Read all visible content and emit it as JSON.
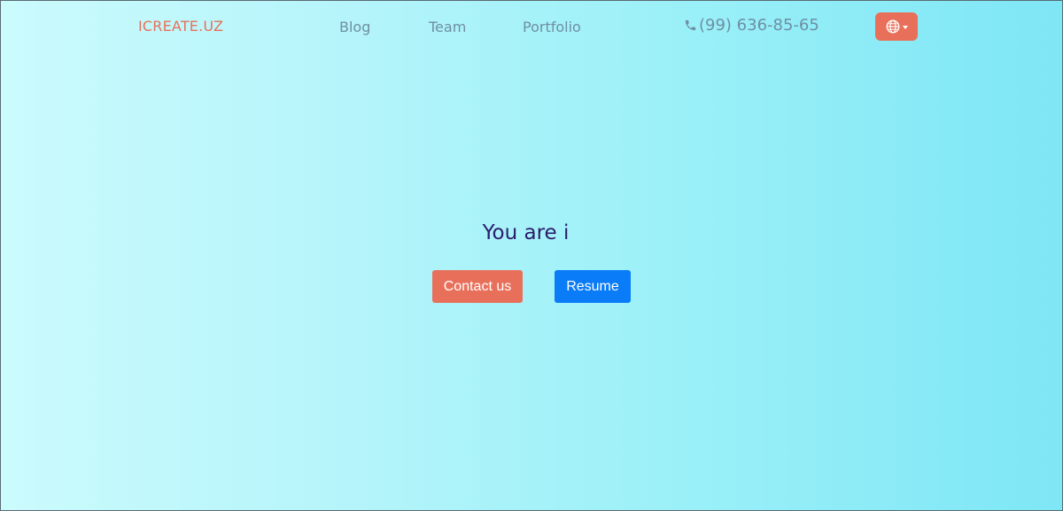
{
  "navbar": {
    "brand": "ICREATE.UZ",
    "links": [
      {
        "label": "Blog"
      },
      {
        "label": "Team"
      },
      {
        "label": "Portfolio"
      }
    ],
    "phone": "(99) 636-85-65",
    "phone_icon": "phone-icon",
    "language_icon": "globe-icon"
  },
  "hero": {
    "title": "You are i",
    "contact_button": "Contact us",
    "resume_button": "Resume"
  },
  "colors": {
    "accent": "#e8705b",
    "primary_button": "#0b7cf7",
    "nav_text": "#6f8fa3",
    "title_text": "#2b1c6b"
  }
}
